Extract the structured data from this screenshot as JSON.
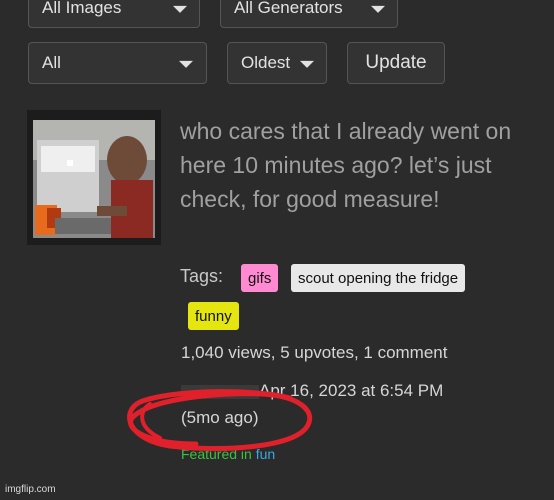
{
  "filters": {
    "row1": [
      {
        "label": "All Images"
      },
      {
        "label": "All Generators"
      }
    ],
    "row2": {
      "category": "All",
      "sort": "Oldest",
      "update_label": "Update"
    }
  },
  "post": {
    "title": "who cares that I already went on here 10 minutes ago? let’s just check, for good measure!",
    "tags_label": "Tags:",
    "tags": [
      {
        "label": "gifs",
        "color": "#ff8ad1"
      },
      {
        "label": "scout opening the fridge",
        "color": "#e8e8e8"
      },
      {
        "label": "funny",
        "color": "#e5e510"
      }
    ],
    "stats": "1,040 views, 5 upvotes, 1 comment",
    "date": "Apr 16, 2023 at 6:54 PM",
    "ago": "(5mo ago)",
    "featured_prefix": "Featured in",
    "featured_stream": "fun",
    "featured_prefix_color": "#3fbf3f",
    "featured_stream_color": "#37a8e8"
  },
  "annotation_color": "#e0202a",
  "watermark": "imgflip.com"
}
